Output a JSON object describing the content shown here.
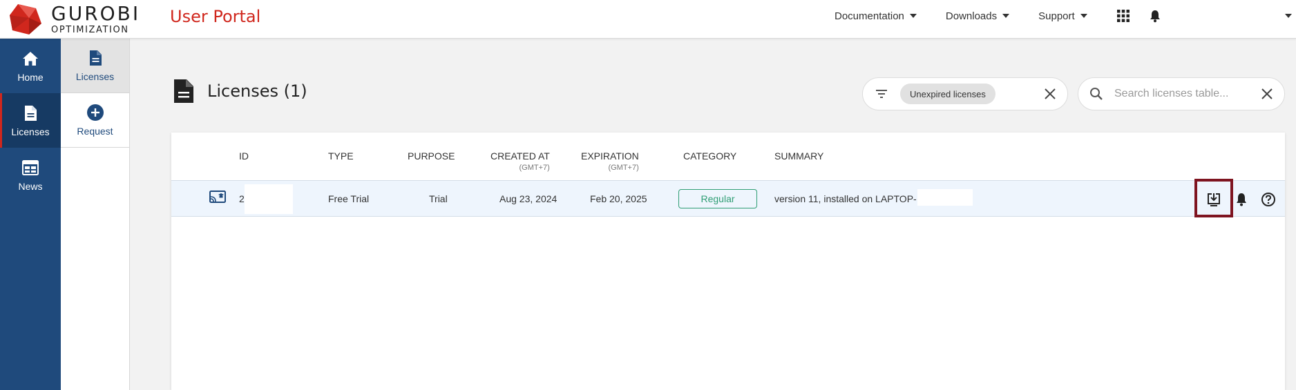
{
  "header": {
    "logo_main": "GUROBI",
    "logo_sub": "OPTIMIZATION",
    "portal_title": "User Portal",
    "nav": [
      {
        "label": "Documentation"
      },
      {
        "label": "Downloads"
      },
      {
        "label": "Support"
      }
    ],
    "brand_color": "#d0271d"
  },
  "leftnav": {
    "items": [
      {
        "label": "Home",
        "icon": "home-icon"
      },
      {
        "label": "Licenses",
        "icon": "document-icon",
        "active": true
      },
      {
        "label": "News",
        "icon": "calendar-icon"
      }
    ],
    "color": "#1f4a7c"
  },
  "subnav": {
    "items": [
      {
        "label": "Licenses",
        "icon": "document-icon",
        "active": true
      },
      {
        "label": "Request",
        "icon": "plus-circle-icon"
      }
    ]
  },
  "page": {
    "title": "Licenses (1)",
    "filter_chip": "Unexpired licenses",
    "search_placeholder": "Search licenses table..."
  },
  "table": {
    "columns": [
      {
        "label": "ID"
      },
      {
        "label": "TYPE"
      },
      {
        "label": "PURPOSE"
      },
      {
        "label": "CREATED AT",
        "sub": "(GMT+7)"
      },
      {
        "label": "EXPIRATION",
        "sub": "(GMT+7)"
      },
      {
        "label": "CATEGORY"
      },
      {
        "label": "SUMMARY"
      }
    ],
    "rows": [
      {
        "id": "2",
        "type": "Free Trial",
        "purpose": "Trial",
        "created_at": "Aug 23, 2024",
        "expiration": "Feb 20, 2025",
        "category": "Regular",
        "summary": "version 11, installed on LAPTOP-"
      }
    ]
  }
}
